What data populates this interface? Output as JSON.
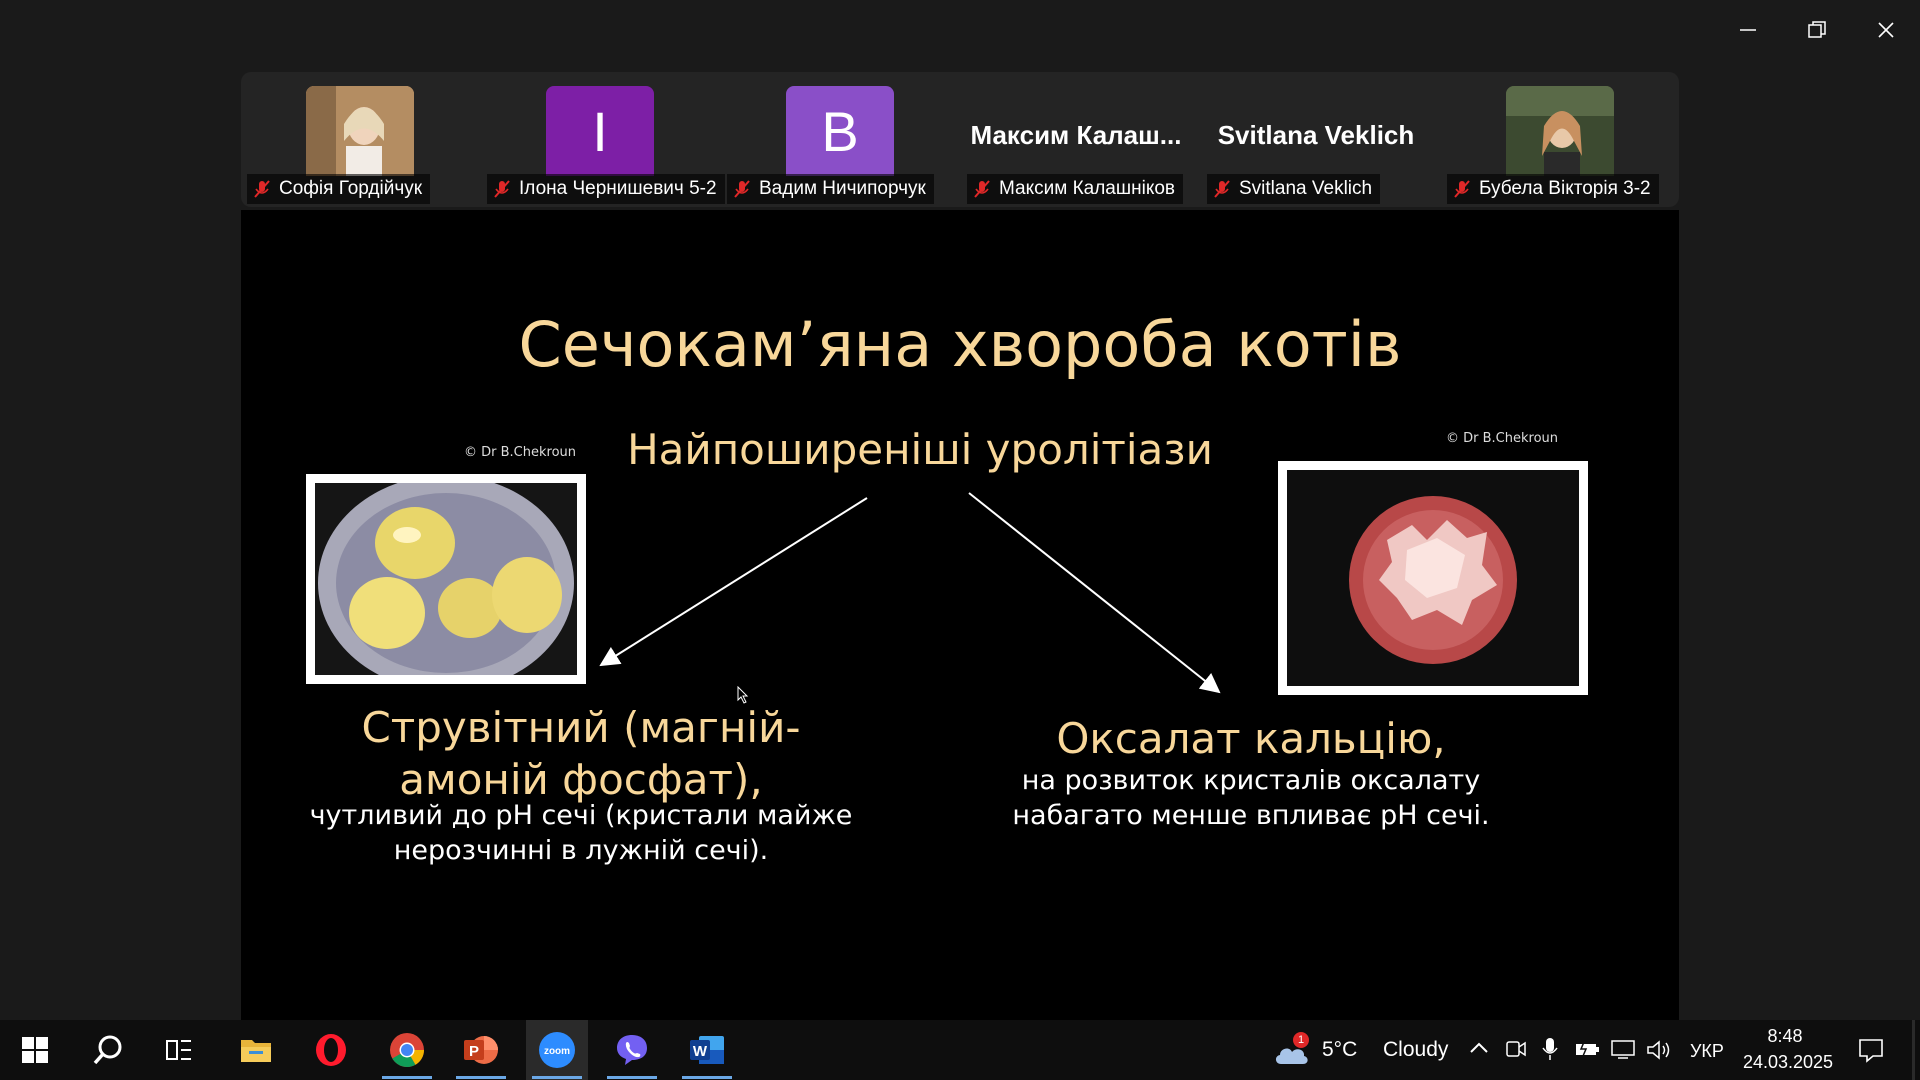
{
  "participants": [
    {
      "name": "Софія Гордійчук",
      "type": "photo",
      "photo_color": "#c9a27a"
    },
    {
      "name": "Ілона Чернишевич 5-2",
      "type": "initial",
      "initial": "I",
      "color": "#7d1fa6"
    },
    {
      "name": "Вадим Ничипорчук",
      "type": "initial",
      "initial": "B",
      "color": "#8a4fc8"
    },
    {
      "name": "Максим Калашніков",
      "type": "name",
      "display": "Максим Калаш..."
    },
    {
      "name": "Svitlana Veklich",
      "type": "name",
      "display": "Svitlana Veklich"
    },
    {
      "name": "Бубела Вікторія 3-2",
      "type": "photo",
      "photo_color": "#4a5a3a"
    }
  ],
  "slide": {
    "title": "Сечокам’яна хвороба котів",
    "subtitle": "Найпоширеніші уролітіази",
    "credit_left": "© Dr B.Chekroun",
    "credit_right": "© Dr B.Chekroun",
    "left_heading": "Струвітний (магній-амоній фосфат),",
    "left_heading_line1": "Струвітний (магній-",
    "left_heading_line2": "амоній фосфат),",
    "left_body_line1": "чутливий до pH сечі (кристали майже",
    "left_body_line2": "нерозчинні в лужній сечі).",
    "right_heading": "Оксалат кальцію,",
    "right_body_line1": "на розвиток кристалів оксалату",
    "right_body_line2": "набагато менше впливає pH сечі."
  },
  "taskbar": {
    "weather_temp": "5°C",
    "weather_desc": "Cloudy",
    "weather_badge": "1",
    "language": "УКР",
    "time": "8:48",
    "date": "24.03.2025",
    "apps": [
      "start-icon",
      "search-icon",
      "task-view-icon",
      "file-explorer-icon",
      "opera-icon",
      "chrome-icon",
      "powerpoint-icon",
      "zoom-icon",
      "viber-icon",
      "word-icon"
    ]
  },
  "colors": {
    "slide_accent": "#f8d79a",
    "zoom_blue": "#2d8cff",
    "mic_muted": "#e02828"
  }
}
